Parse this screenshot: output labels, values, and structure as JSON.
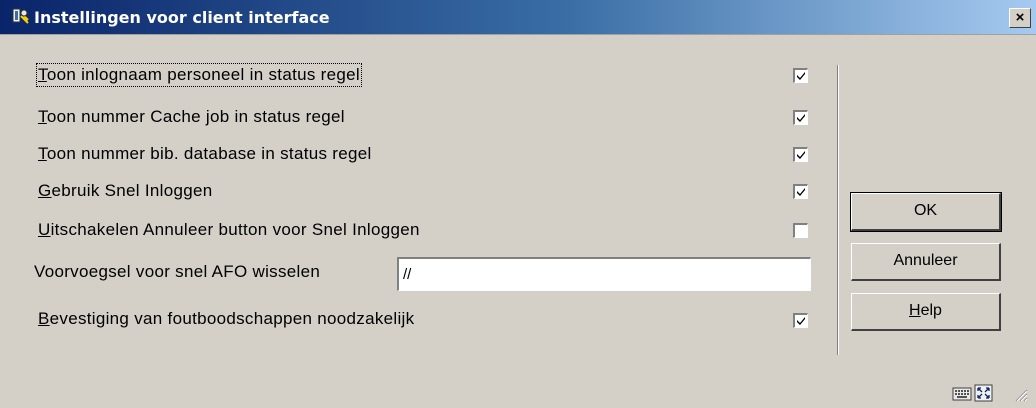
{
  "window": {
    "title": "Instellingen voor client interface",
    "close_glyph": "×",
    "app_icon": "app-icon"
  },
  "options": [
    {
      "accel": "T",
      "rest": "oon inlognaam personeel in status regel",
      "checked": true
    },
    {
      "accel": "T",
      "rest": "oon nummer Cache job in status regel",
      "checked": true
    },
    {
      "accel": "T",
      "rest": "oon nummer bib. database in status regel",
      "checked": true
    },
    {
      "accel": "G",
      "rest": "ebruik Snel Inloggen",
      "checked": true
    },
    {
      "accel": "U",
      "rest": "itschakelen Annuleer button voor Snel Inloggen",
      "checked": false
    }
  ],
  "prefix_field": {
    "label": "Voorvoegsel voor snel AFO wisselen",
    "value": "//"
  },
  "confirm_option": {
    "accel": "B",
    "rest": "evestiging van foutboodschappen noodzakelijk",
    "checked": true
  },
  "buttons": {
    "ok": "OK",
    "cancel": "Annuleer",
    "help_accel": "H",
    "help_rest": "elp"
  },
  "status_icons": [
    "keyboard-icon",
    "resize-window-icon",
    "size-grip-icon"
  ]
}
